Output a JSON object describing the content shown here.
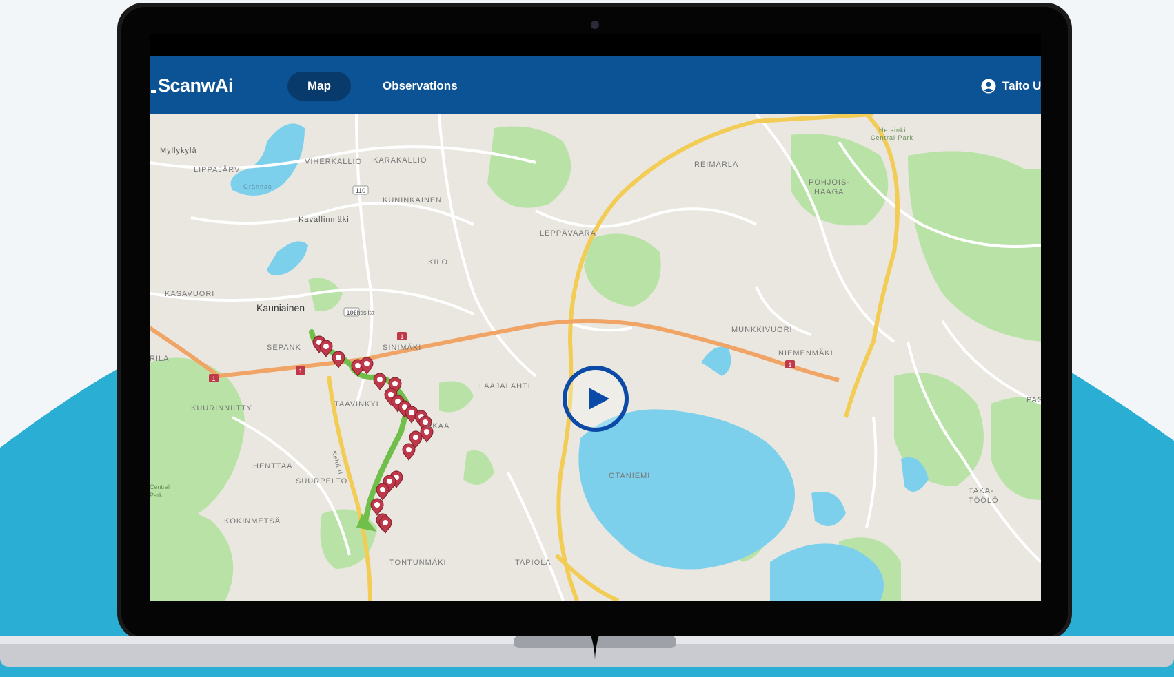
{
  "app": {
    "brand": "ScanwAi",
    "nav": {
      "map_label": "Map",
      "observations_label": "Observations"
    },
    "user_label": "Taito Us"
  },
  "map": {
    "place_labels": {
      "myllykyla": "Myllykylä",
      "lippajarvi": "LIPPAJÄRV",
      "grannas": "Grännas",
      "viherkallio": "VIHERKALLIO",
      "karakallio": "KARAKALLIO",
      "kuninkainen": "KUNINKAINEN",
      "kavallinmaki": "Kavallinmäki",
      "leppavaara": "LEPPÄVAARA",
      "reimarla": "REIMARLA",
      "pohjois_haaga_1": "POHJOIS-",
      "pohjois_haaga_2": "HAAGA",
      "central_park_1": "Helsinki",
      "central_park_2": "Central Park",
      "kilo": "KILO",
      "kasavuori": "KASAVUORI",
      "kauniainen": "Kauniainen",
      "nihtisilta": "Nihtisilta",
      "munkkivuori": "MUNKKIVUORI",
      "niemenmaki": "NIEMENMÄKI",
      "sepanky": "SEPANK",
      "sinimaki": "SINIMÄKI",
      "ila": "RILA",
      "laajalahti": "LAAJALAHTI",
      "kuurinniitty": "KUURINNIITTY",
      "taavinkyla": "TAAVINKYL",
      "kkaa": "KKAA",
      "pas": "PAS",
      "henttaa": "HENTTAA",
      "suurpelto": "SUURPELTO",
      "otaniemi": "OTANIEMI",
      "central_park_left_1": "Central",
      "central_park_left_2": "Park",
      "kehaii": "Kehä II",
      "taka_toolo_1": "TAKA-",
      "taka_toolo_2": "TÖÖLÖ",
      "kokinmetsa": "KOKINMETSÄ",
      "tontunmaki": "TONTUNMÄKI",
      "tapiola": "TAPIOLA"
    },
    "road_badges": {
      "r110": "110",
      "r102": "102",
      "r1a": "1",
      "r1b": "1",
      "r1c": "1",
      "r1d": "1"
    }
  },
  "colors": {
    "brand_blue": "#0b5394",
    "nav_active": "#083a6b",
    "route_green": "#6fbf4a",
    "marker_red": "#c0394b",
    "water": "#7dd0ec",
    "park": "#b9e3a6",
    "backdrop_teal": "#2aaed3",
    "play_blue": "#0b4aa6"
  },
  "icons": {
    "play": "play-icon",
    "user": "account-circle-icon",
    "marker": "map-pin-icon"
  }
}
